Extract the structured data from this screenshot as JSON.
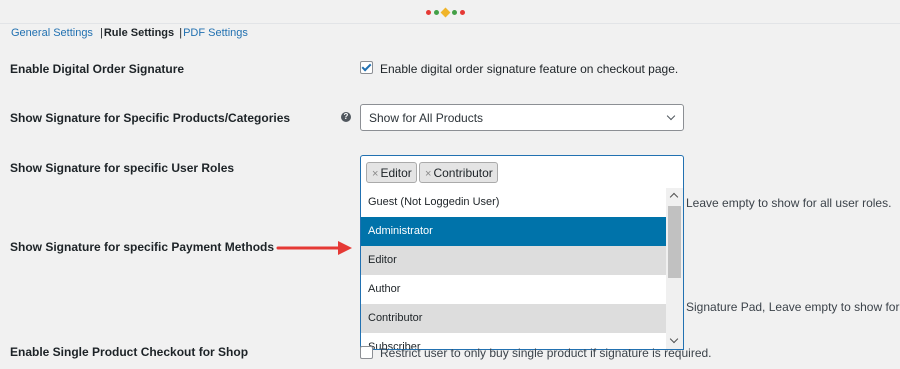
{
  "nav": {
    "tabs": [
      {
        "label": "General Settings"
      },
      {
        "label": "Rule Settings"
      },
      {
        "label": "PDF Settings"
      }
    ],
    "separator": "|"
  },
  "rows": {
    "enable_signature": {
      "label": "Enable Digital Order Signature",
      "checkbox_label": "Enable digital order signature feature on checkout page.",
      "checked": true
    },
    "products": {
      "label": "Show Signature for Specific Products/Categories",
      "help_icon": "?",
      "selected": "Show for All Products"
    },
    "user_roles": {
      "label": "Show Signature for specific User Roles",
      "selected_tags": [
        {
          "remove": "×",
          "label": "Editor"
        },
        {
          "remove": "×",
          "label": "Contributor"
        }
      ],
      "options": [
        {
          "label": "Guest (Not Loggedin User)",
          "state": "normal"
        },
        {
          "label": "Administrator",
          "state": "highlighted"
        },
        {
          "label": "Editor",
          "state": "selected"
        },
        {
          "label": "Author",
          "state": "normal"
        },
        {
          "label": "Contributor",
          "state": "selected"
        },
        {
          "label": "Subscriber",
          "state": "normal"
        }
      ],
      "description": "Leave empty to show for all user roles."
    },
    "payment_methods": {
      "label": "Show Signature for specific Payment Methods",
      "description": "Signature Pad, Leave empty to show for all"
    },
    "single_product": {
      "label": "Enable Single Product Checkout for Shop",
      "checkbox_label": "Restrict user to only buy single product if signature is required.",
      "checked": false
    }
  },
  "colors": {
    "accent": "#2271b1",
    "highlight": "#0073aa",
    "annotation_arrow": "#e53935"
  }
}
